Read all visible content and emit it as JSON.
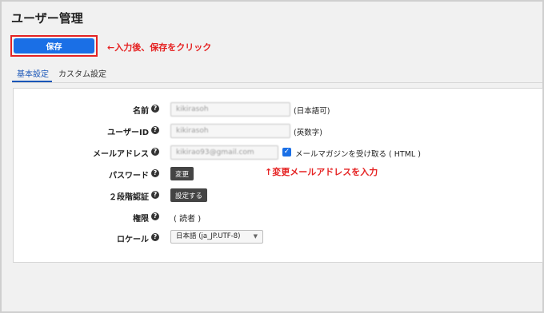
{
  "page": {
    "title": "ユーザー管理"
  },
  "toolbar": {
    "save_label": "保存"
  },
  "annotations": {
    "save_hint": "←入力後、保存をクリック",
    "email_hint": "↑変更メールアドレスを入力"
  },
  "tabs": [
    {
      "label": "基本設定",
      "active": true
    },
    {
      "label": "カスタム設定",
      "active": false
    }
  ],
  "form": {
    "name": {
      "label": "名前",
      "value": "kikirasoh",
      "suffix": "(日本語可)"
    },
    "user_id": {
      "label": "ユーザーID",
      "value": "kikirasoh",
      "suffix": "(英数字)"
    },
    "email": {
      "label": "メールアドレス",
      "value": "kikirao93@gmail.com",
      "newsletter_label": "メールマガジンを受け取る ( HTML )",
      "newsletter_checked": true
    },
    "password": {
      "label": "パスワード",
      "button": "変更"
    },
    "two_factor": {
      "label": "２段階認証",
      "button": "設定する"
    },
    "role": {
      "label": "権限",
      "value": "( 読者 )"
    },
    "locale": {
      "label": "ロケール",
      "value": "日本語 (ja_JP.UTF-8)"
    }
  },
  "icons": {
    "help": "help-icon",
    "check": "check-icon",
    "chevron": "chevron-down-icon"
  },
  "colors": {
    "primary": "#1a6fe6",
    "annotation": "#e52222",
    "tab_active": "#1a56b8"
  }
}
